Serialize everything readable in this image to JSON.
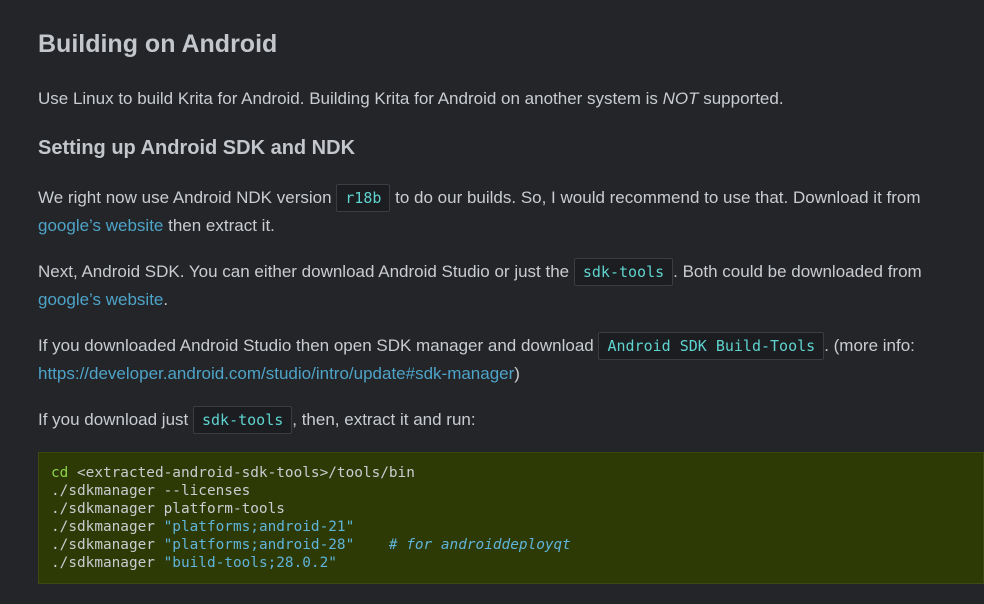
{
  "heading": "Building on Android",
  "intro": {
    "before": "Use Linux to build Krita for Android. Building Krita for Android on another system is ",
    "emph": "NOT",
    "after": " supported."
  },
  "subheading": "Setting up Android SDK and NDK",
  "p1": {
    "t1": "We right now use Android NDK version ",
    "code": "r18b",
    "t2": " to do our builds. So, I would recommend to use that. Download it from",
    "link": "google’s website",
    "t3": " then extract it."
  },
  "p2": {
    "t1": "Next, Android SDK. You can either download Android Studio or just the ",
    "code": "sdk-tools",
    "t2": ". Both could be downloaded from",
    "link": "google’s website",
    "t3": "."
  },
  "p3": {
    "t1": "If you downloaded Android Studio then open SDK manager and download ",
    "code": "Android SDK Build-Tools",
    "t2": ". (more info:",
    "link": "https://developer.android.com/studio/intro/update#sdk-manager",
    "t3": ")"
  },
  "p4": {
    "t1": "If you download just ",
    "code": "sdk-tools",
    "t2": ", then, extract it and run:"
  },
  "code_block": {
    "l1_kw": "cd",
    "l1_rest": " <extracted-android-sdk-tools>/tools/bin",
    "l2": "./sdkmanager --licenses",
    "l3": "./sdkmanager platform-tools",
    "l4_cmd": "./sdkmanager ",
    "l4_str": "\"platforms;android-21\"",
    "l5_cmd": "./sdkmanager ",
    "l5_str": "\"platforms;android-28\"",
    "l5_pad": "    ",
    "l5_cmt": "# for androiddeployqt",
    "l6_cmd": "./sdkmanager ",
    "l6_str": "\"build-tools;28.0.2\""
  },
  "colors": {
    "background": "#232528",
    "text": "#c9ccd0",
    "link": "#4ea3c8",
    "inline_code": "#5fd3cf",
    "code_block_bg": "#2e3a06",
    "code_keyword": "#8fd34a",
    "code_string": "#5fb3d9"
  }
}
